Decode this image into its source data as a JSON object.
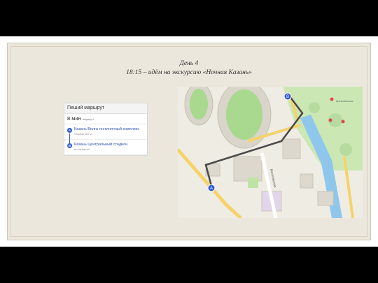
{
  "slide": {
    "title_line1": "День 4",
    "title_line2": "18:15 – идём на экскурсию «Ночная Казань»"
  },
  "route_panel": {
    "header": "Пеший маршрут",
    "duration": "8 мин",
    "duration_note": "маршрут",
    "stops": [
      {
        "marker": "A",
        "name": "Казань Волга гостиничный комплекс",
        "detail": "пешком 610 м"
      },
      {
        "marker": "B",
        "name": "Казань Центральный стадион",
        "detail": "вы на месте!"
      }
    ]
  },
  "map": {
    "markers": [
      "A",
      "B"
    ],
    "route_color": "#4a4a4a",
    "park_color": "#bfe3a5",
    "road_color": "#f5d36a",
    "water_color": "#7fbfe8",
    "labels": [
      "Московская",
      "Кремлёвская"
    ]
  }
}
